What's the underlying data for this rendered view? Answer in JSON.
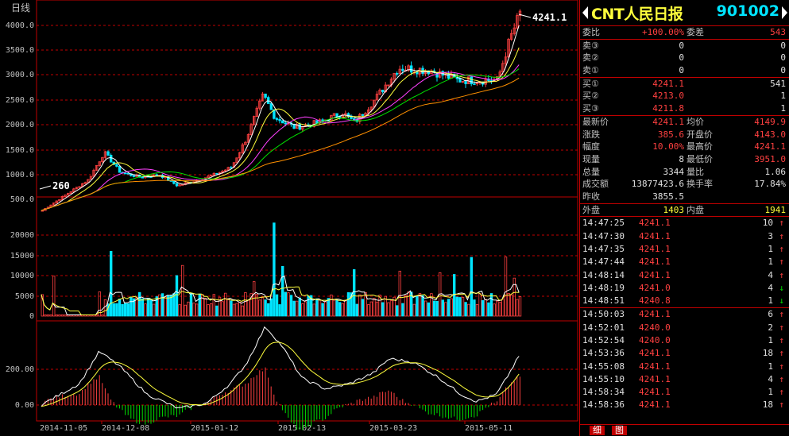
{
  "chart": {
    "period_label": "日线",
    "last_price_label": "4241.1",
    "start_price_label": "260",
    "price_ticks": [
      "4000.0",
      "3500.0",
      "3000.0",
      "2500.0",
      "2000.0",
      "1500.0",
      "1000.0",
      "500.0"
    ],
    "volume_ticks": [
      "20000",
      "15000",
      "10000",
      "5000",
      "0"
    ],
    "macd_ticks": [
      "200.00",
      "0.00"
    ],
    "date_ticks": [
      "2014-11-05",
      "2014-12-08",
      "2015-01-12",
      "2015-02-13",
      "2015-03-23",
      "2015-05-11"
    ]
  },
  "quote": {
    "name": "CNT人民日报",
    "code": "901002",
    "weibi_label": "委比",
    "weibi_value": "+100.00%",
    "weicha_label": "委差",
    "weicha_value": "543",
    "sells": [
      {
        "label": "卖③",
        "price": "0",
        "qty": "0"
      },
      {
        "label": "卖②",
        "price": "0",
        "qty": "0"
      },
      {
        "label": "卖①",
        "price": "0",
        "qty": "0"
      }
    ],
    "buys": [
      {
        "label": "买①",
        "price": "4241.1",
        "qty": "541"
      },
      {
        "label": "买②",
        "price": "4213.0",
        "qty": "1"
      },
      {
        "label": "买③",
        "price": "4211.8",
        "qty": "1"
      }
    ],
    "stats": [
      {
        "l1": "最新价",
        "v1": "4241.1",
        "c1": "red",
        "l2": "均价",
        "v2": "4149.9",
        "c2": "red"
      },
      {
        "l1": "涨跌",
        "v1": "385.6",
        "c1": "red",
        "l2": "开盘价",
        "v2": "4143.0",
        "c2": "red"
      },
      {
        "l1": "幅度",
        "v1": "10.00%",
        "c1": "red",
        "l2": "最高价",
        "v2": "4241.1",
        "c2": "red"
      },
      {
        "l1": "现量",
        "v1": "8",
        "c1": "wht",
        "l2": "最低价",
        "v2": "3951.0",
        "c2": "red"
      },
      {
        "l1": "总量",
        "v1": "3344",
        "c1": "wht",
        "l2": "量比",
        "v2": "1.06",
        "c2": "wht"
      },
      {
        "l1": "成交额",
        "v1": "13877423.6",
        "c1": "wht",
        "l2": "换手率",
        "v2": "17.84%",
        "c2": "wht"
      }
    ],
    "prev_close_label": "昨收",
    "prev_close_value": "3855.5",
    "outer_label": "外盘",
    "outer_value": "1403",
    "inner_label": "内盘",
    "inner_value": "1941"
  },
  "ticks": [
    {
      "time": "14:47:25",
      "price": "4241.1",
      "vol": "10",
      "dir": "up"
    },
    {
      "time": "14:47:30",
      "price": "4241.1",
      "vol": "3",
      "dir": "up"
    },
    {
      "time": "14:47:35",
      "price": "4241.1",
      "vol": "1",
      "dir": "up"
    },
    {
      "time": "14:47:44",
      "price": "4241.1",
      "vol": "1",
      "dir": "up"
    },
    {
      "time": "14:48:14",
      "price": "4241.1",
      "vol": "4",
      "dir": "up"
    },
    {
      "time": "14:48:19",
      "price": "4241.0",
      "vol": "4",
      "dir": "down"
    },
    {
      "time": "14:48:51",
      "price": "4240.8",
      "vol": "1",
      "dir": "down"
    },
    {
      "time": "14:50:03",
      "price": "4241.1",
      "vol": "6",
      "dir": "up"
    },
    {
      "time": "14:52:01",
      "price": "4240.0",
      "vol": "2",
      "dir": "up"
    },
    {
      "time": "14:52:54",
      "price": "4240.0",
      "vol": "1",
      "dir": "up"
    },
    {
      "time": "14:53:36",
      "price": "4241.1",
      "vol": "18",
      "dir": "up"
    },
    {
      "time": "14:55:08",
      "price": "4241.1",
      "vol": "1",
      "dir": "up"
    },
    {
      "time": "14:55:10",
      "price": "4241.1",
      "vol": "4",
      "dir": "up"
    },
    {
      "time": "14:58:34",
      "price": "4241.1",
      "vol": "1",
      "dir": "up"
    },
    {
      "time": "14:58:36",
      "price": "4241.1",
      "vol": "18",
      "dir": "up"
    }
  ],
  "tabs": {
    "detail": "细",
    "chart": "图"
  },
  "colors": {
    "up": "#ff4040",
    "down": "#00e4ff",
    "grid": "#c00000",
    "ma1": "#ffffff",
    "ma2": "#ffff3c",
    "ma3": "#ff40ff",
    "ma4": "#00e000",
    "ma5": "#ff9000"
  }
}
